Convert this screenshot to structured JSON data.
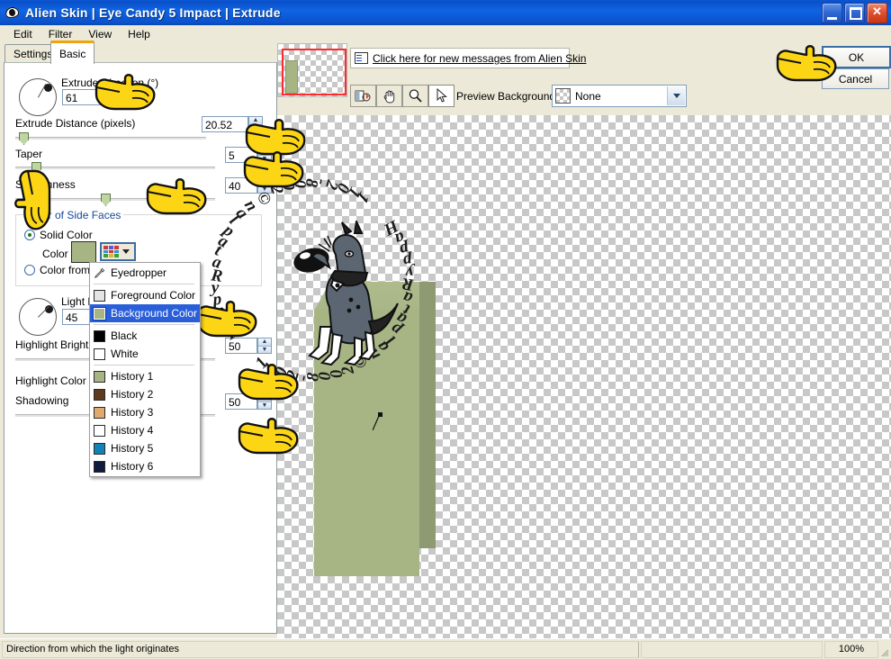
{
  "window": {
    "title": "Alien Skin | Eye Candy 5 Impact | Extrude",
    "icon": "eye-icon",
    "buttons": {
      "minimize": "minimize-icon",
      "maximize": "maximize-icon",
      "close": "close-icon"
    }
  },
  "menubar": {
    "items": [
      "Edit",
      "Filter",
      "View",
      "Help"
    ]
  },
  "tabs": [
    {
      "label": "Settings",
      "active": false
    },
    {
      "label": "Basic",
      "active": true
    }
  ],
  "controls": {
    "extrude_direction": {
      "label": "Extrude Direction (°)",
      "value": "61"
    },
    "extrude_distance": {
      "label": "Extrude Distance (pixels)",
      "value": "20.52"
    },
    "taper": {
      "label": "Taper",
      "value": "5"
    },
    "smoothness": {
      "label": "Smoothness",
      "value": "40"
    },
    "light_direction": {
      "label": "Light D",
      "full_label": "Light Direction (°)",
      "value": "45"
    },
    "highlight_brightness": {
      "label": "Highlight Brightnes",
      "value": "50"
    },
    "highlight_color": {
      "label": "Highlight Color"
    },
    "shadowing": {
      "label": "Shadowing",
      "value": "50"
    }
  },
  "side_faces_group": {
    "title": "Color of Side Faces",
    "solid_color": {
      "label": "Solid Color",
      "selected": true
    },
    "color_label": "Color",
    "color_value": "#a7b585",
    "color_from_original": {
      "label": "Color from Or",
      "full_label": "Color from Original",
      "selected": false
    }
  },
  "color_dropdown": {
    "items": [
      {
        "label": "Eyedropper",
        "type": "eyedropper",
        "selected": false
      },
      {
        "label": "Foreground Color",
        "swatch": "#e4e4e4",
        "selected": false
      },
      {
        "label": "Background Color",
        "swatch": "#a7b585",
        "selected": true
      },
      {
        "label": "Black",
        "swatch": "#000000",
        "selected": false
      },
      {
        "label": "White",
        "swatch": "#ffffff",
        "selected": false
      },
      {
        "label": "History 1",
        "swatch": "#a7b585",
        "selected": false
      },
      {
        "label": "History 2",
        "swatch": "#5c3a1e",
        "selected": false
      },
      {
        "label": "History 3",
        "swatch": "#e0aa6e",
        "selected": false
      },
      {
        "label": "History 4",
        "swatch": "#ffffff",
        "selected": false
      },
      {
        "label": "History 5",
        "swatch": "#1383b5",
        "selected": false
      },
      {
        "label": "History 6",
        "swatch": "#101c3e",
        "selected": false
      }
    ]
  },
  "preview": {
    "message_link": "Click here for new messages from Alien Skin",
    "message_icon": "message-icon",
    "tools": [
      {
        "name": "preview-split-icon",
        "active": false
      },
      {
        "name": "hand-icon",
        "active": false
      },
      {
        "name": "zoom-icon",
        "active": false
      },
      {
        "name": "arrow-icon",
        "active": true
      }
    ],
    "background_label": "Preview Background:",
    "background_value": "None",
    "shape_front_color": "#a7b585",
    "shape_side_color": "#8e9a72",
    "watermark": {
      "top_text": "HappyRataplan © 2008-2011",
      "bottom_text": "HappyRataplan © 2008-2011"
    }
  },
  "actions": {
    "ok": "OK",
    "cancel": "Cancel"
  },
  "statusbar": {
    "hint": "Direction from which the light originates",
    "zoom": "100%"
  }
}
